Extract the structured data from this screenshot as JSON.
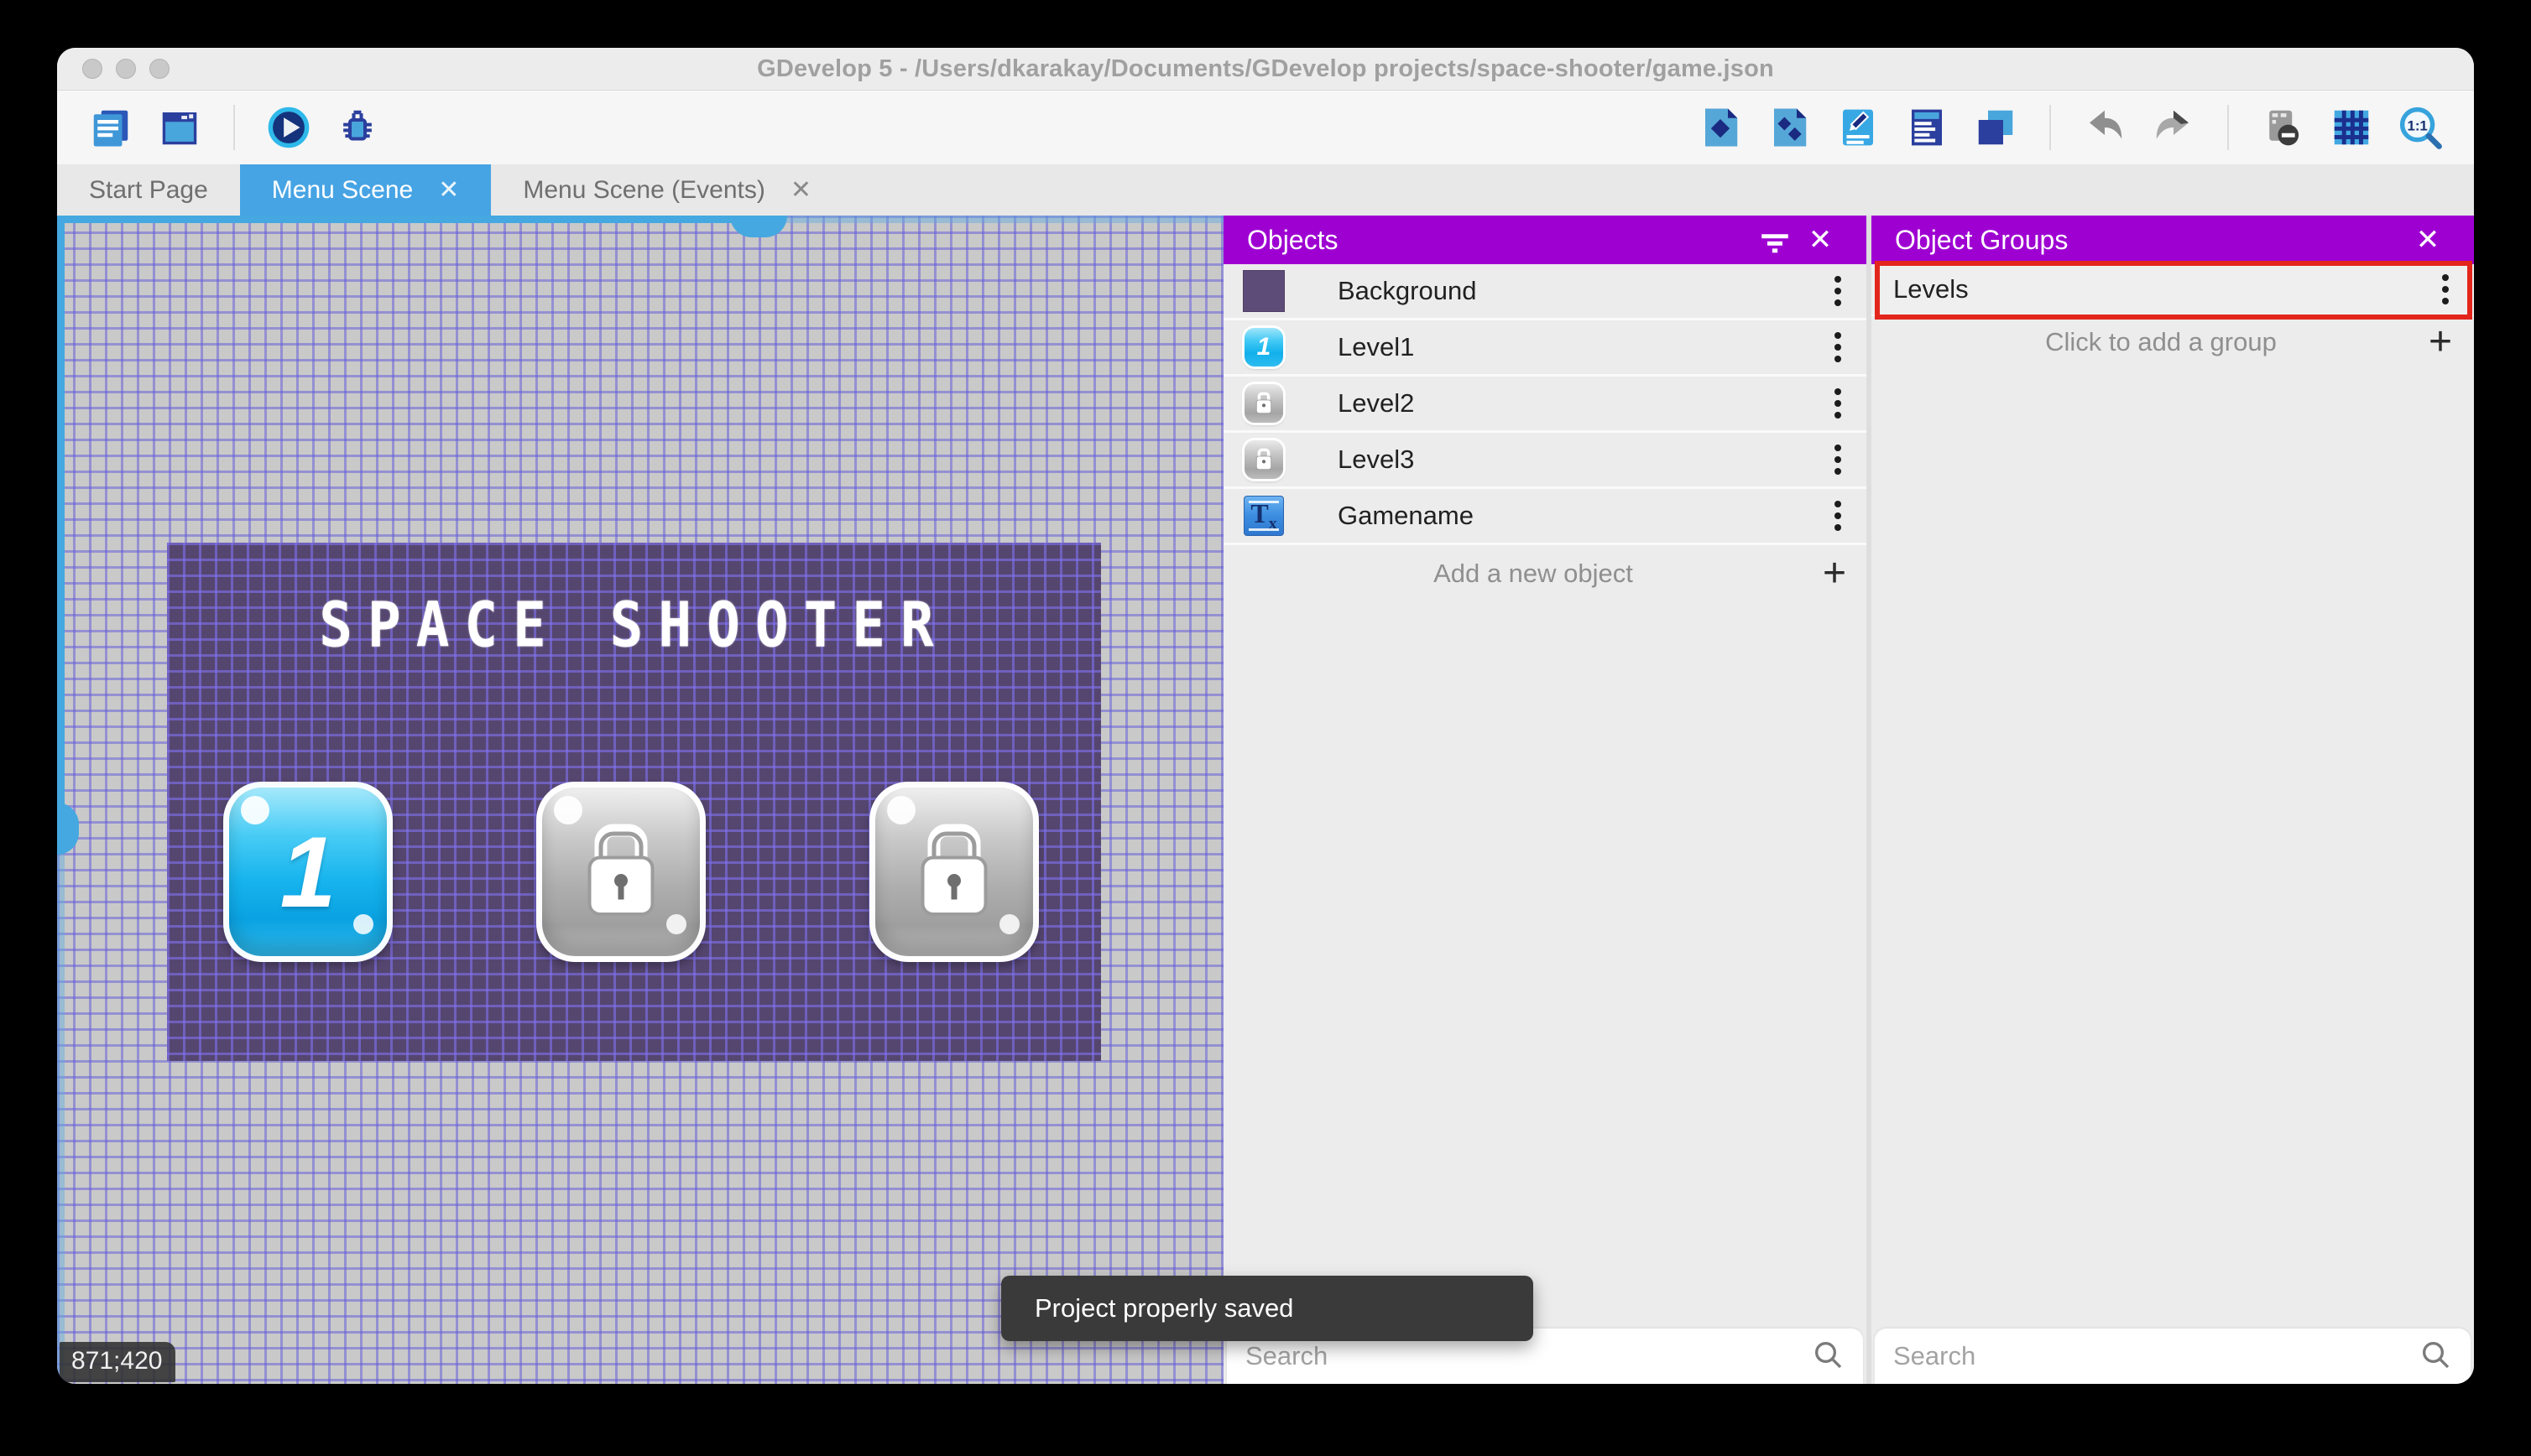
{
  "window": {
    "title": "GDevelop 5 - /Users/dkarakay/Documents/GDevelop projects/space-shooter/game.json"
  },
  "toolbar": {
    "left_icons": [
      "project-manager-icon",
      "editors-window-icon",
      "preview-play-icon",
      "debug-icon"
    ],
    "right_icons": [
      "objects-editor-icon",
      "object-groups-editor-icon",
      "properties-icon",
      "instances-list-icon",
      "layers-editor-icon",
      "undo-icon",
      "redo-icon",
      "render-mask-icon",
      "grid-icon",
      "zoom-1-1-icon"
    ]
  },
  "tabs": [
    {
      "label": "Start Page",
      "active": false,
      "closable": false
    },
    {
      "label": "Menu Scene",
      "active": true,
      "closable": true,
      "close_glyph": "✕"
    },
    {
      "label": "Menu Scene (Events)",
      "active": false,
      "closable": true,
      "close_glyph": "✕"
    }
  ],
  "canvas": {
    "coordinates": "871;420",
    "scene": {
      "title_text": "SPACE SHOOTER",
      "level_buttons": [
        {
          "label": "1",
          "locked": false
        },
        {
          "label": "",
          "locked": true
        },
        {
          "label": "",
          "locked": true
        }
      ]
    }
  },
  "objects_panel": {
    "title": "Objects",
    "items": [
      {
        "name": "Background",
        "thumb": "purple-swatch"
      },
      {
        "name": "Level1",
        "thumb": "blue-button-1"
      },
      {
        "name": "Level2",
        "thumb": "gray-lock-button"
      },
      {
        "name": "Level3",
        "thumb": "gray-lock-button"
      },
      {
        "name": "Gamename",
        "thumb": "text-object"
      }
    ],
    "add_label": "Add a new object",
    "add_glyph": "+",
    "search_placeholder": "Search"
  },
  "object_groups_panel": {
    "title": "Object Groups",
    "groups": [
      {
        "name": "Levels",
        "highlighted": true
      }
    ],
    "add_label": "Click to add a group",
    "add_glyph": "+",
    "search_placeholder": "Search"
  },
  "toast": {
    "message": "Project properly saved"
  },
  "colors": {
    "panel_header_purple": "#9e00d2",
    "active_tab_blue": "#47a4e4",
    "highlight_red": "#e2261c",
    "scene_purple": "#554670",
    "canvas_gray": "#c9c9c9",
    "grid_line": "#645cda",
    "scrollbar_blue": "#45a8e0",
    "toast_bg": "#3a3a3a"
  }
}
